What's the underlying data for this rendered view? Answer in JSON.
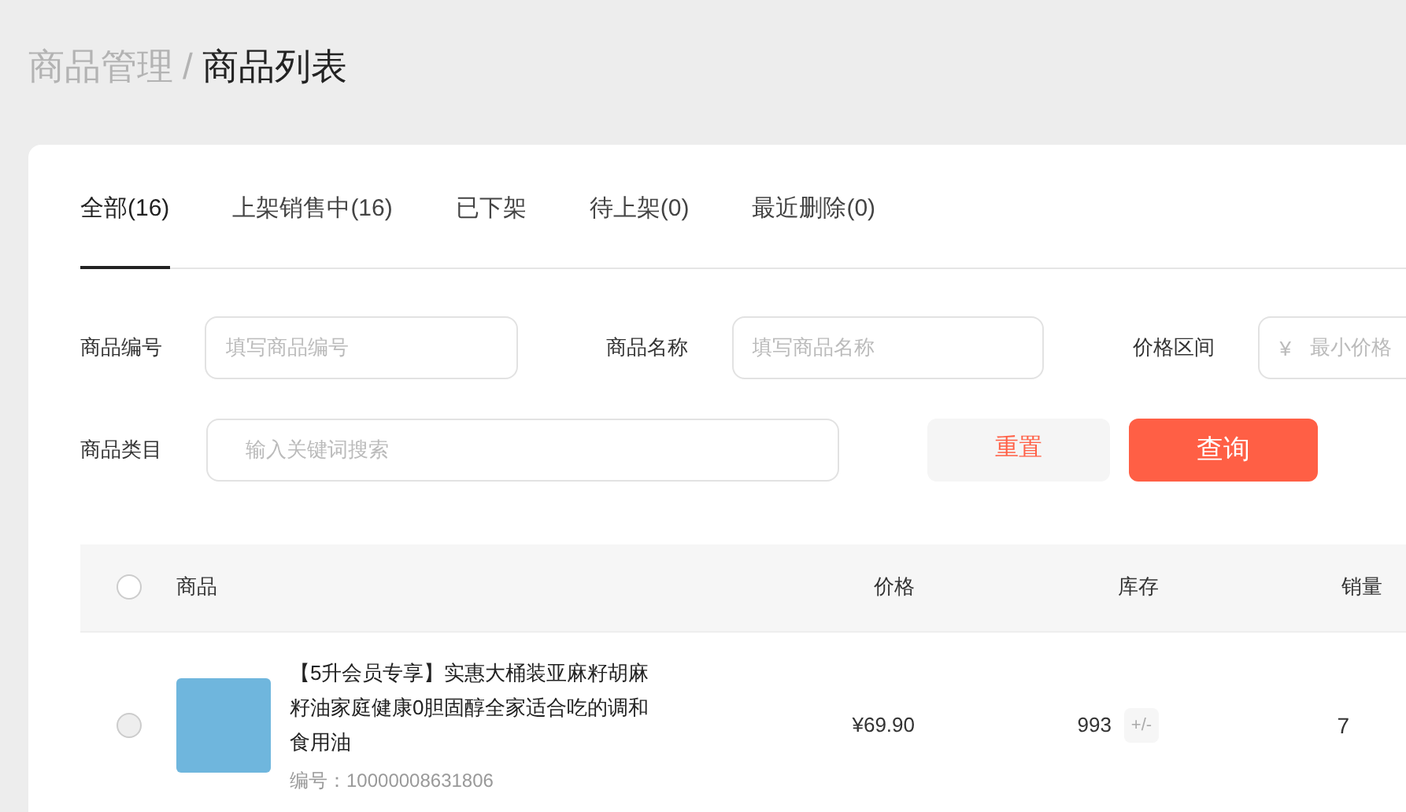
{
  "breadcrumb": {
    "parent": "商品管理",
    "separator": "/",
    "current": "商品列表"
  },
  "tabs": [
    {
      "label": "全部(16)",
      "selected": true
    },
    {
      "label": "上架销售中(16)",
      "selected": false
    },
    {
      "label": "已下架",
      "selected": false
    },
    {
      "label": "待上架(0)",
      "selected": false
    },
    {
      "label": "最近删除(0)",
      "selected": false
    }
  ],
  "filters": [
    {
      "label": "商品编号",
      "placeholder": "填写商品编号"
    },
    {
      "label": "商品名称",
      "placeholder": "填写商品名称"
    },
    {
      "label": "价格区间",
      "prefix": "¥",
      "placeholder": "最小价格"
    }
  ],
  "category": {
    "label": "商品类目",
    "placeholder": "输入关键词搜索"
  },
  "buttons": [
    {
      "label": "重置",
      "kind": "secondary"
    },
    {
      "label": "查询",
      "kind": "primary"
    }
  ],
  "table": {
    "select_all": {
      "checked": false
    },
    "columns": [
      "商品",
      "价格",
      "库存",
      "销量"
    ],
    "rows": [
      {
        "checked": false,
        "title": "【5升会员专享】实惠大桶装亚麻籽胡麻籽油家庭健康0胆固醇全家适合吃的调和食用油",
        "code": "编号：10000008631806",
        "price": "¥69.90",
        "stock": "993",
        "stock_edit": "+/-",
        "sales": "7"
      }
    ]
  }
}
